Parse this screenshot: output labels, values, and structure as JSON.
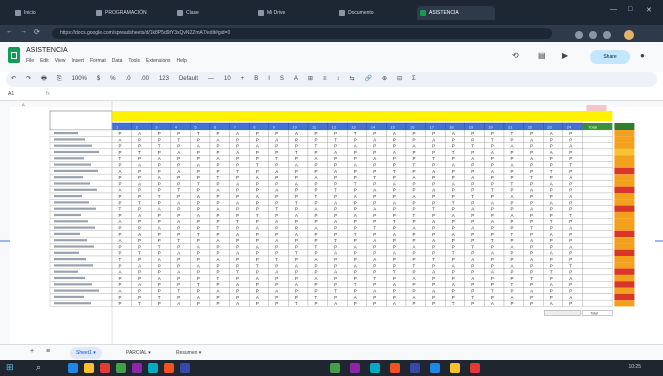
{
  "browser": {
    "tabs": [
      {
        "label": "Inicio",
        "active": false
      },
      {
        "label": "PROGRAMACIÓN",
        "active": false
      },
      {
        "label": "Clase",
        "active": false
      },
      {
        "label": "Mi Drive",
        "active": false
      },
      {
        "label": "Documento",
        "active": false
      },
      {
        "label": "ASISTENCIA",
        "active": true
      }
    ],
    "controls": {
      "minimize": "—",
      "maximize": "□",
      "close": "✕"
    },
    "nav": {
      "back": "←",
      "forward": "→",
      "reload": "⟳"
    },
    "url": "https://docs.google.com/spreadsheets/d/1k8P5d9tY3xQvN2ZmA7/edit#gid=0"
  },
  "doc": {
    "title": "ASISTENCIA",
    "menus": [
      "File",
      "Edit",
      "View",
      "Insert",
      "Format",
      "Data",
      "Tools",
      "Extensions",
      "Help"
    ],
    "share_label": "Share"
  },
  "toolbar": {
    "items": [
      "↶",
      "↷",
      "🖶",
      "⎘",
      "100%",
      "$",
      "%",
      ".0",
      ".00",
      "123",
      "Default",
      "—",
      "10",
      "+",
      "B",
      "I",
      "S",
      "A",
      "⊞",
      "≡",
      "↕",
      "⇆",
      "🔗",
      "⊕",
      "⊟",
      "Σ"
    ]
  },
  "formula": {
    "cell": "A1",
    "fx": "fx"
  },
  "sheet": {
    "title_label": "Total",
    "corner_label": "A",
    "student_count": 28,
    "date_columns": 24,
    "marks": [
      "P",
      "A",
      "P",
      "P",
      "T",
      "P",
      "A",
      "P"
    ],
    "statuses": [
      "ok",
      "ok",
      "ok",
      "warn",
      "ok",
      "ok",
      "bad",
      "ok",
      "ok",
      "bad",
      "ok",
      "ok",
      "bad",
      "ok",
      "ok",
      "ok",
      "bad",
      "ok",
      "ok",
      "bad",
      "ok",
      "ok",
      "bad",
      "ok",
      "bad",
      "ok",
      "bad",
      "ok"
    ],
    "status_colors": {
      "ok": "#f3a01c",
      "warn": "#f7c530",
      "bad": "#d9352a"
    },
    "header_yellow": "#fff200",
    "header_blue": "#4a6fd4",
    "summary_label": "Total"
  },
  "bottom": {
    "tabs": [
      {
        "label": "Sheet1",
        "active": true
      },
      {
        "label": "PARCIAL",
        "active": false
      },
      {
        "label": "Resumen",
        "active": false
      }
    ],
    "add": "+",
    "list": "≡"
  },
  "taskbar": {
    "time": "10:25",
    "icons": [
      "#1e88e5",
      "#fbc02d",
      "#e53935",
      "#43a047",
      "#8e24aa",
      "#00acc1",
      "#f4511e",
      "#3949ab"
    ]
  }
}
